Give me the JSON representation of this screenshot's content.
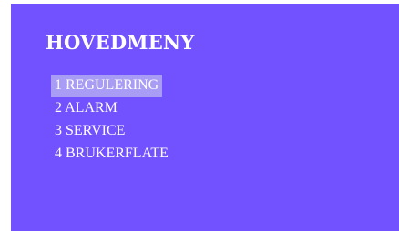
{
  "screen": {
    "background_color": "#7251ff",
    "title": "HOVEDMENY",
    "menu": {
      "selected_index": 0,
      "selected_highlight_color": "#a89cf5",
      "items": [
        {
          "label": "1 REGULERING"
        },
        {
          "label": "2 ALARM"
        },
        {
          "label": "3 SERVICE"
        },
        {
          "label": "4 BRUKERFLATE"
        }
      ]
    }
  }
}
